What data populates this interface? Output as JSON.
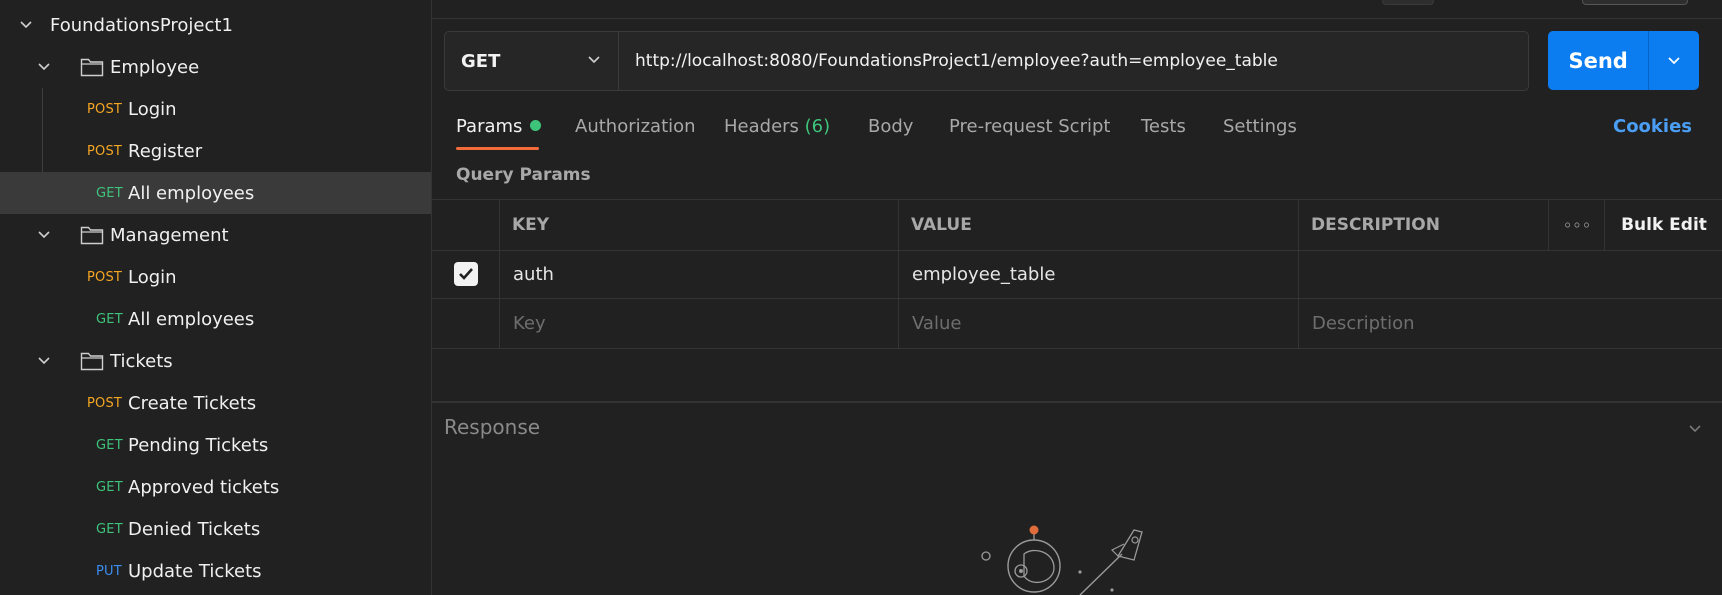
{
  "sidebar": {
    "collection": {
      "name": "FoundationsProject1"
    },
    "folders": [
      {
        "name": "Employee",
        "requests": [
          {
            "method": "POST",
            "name": "Login"
          },
          {
            "method": "POST",
            "name": "Register"
          },
          {
            "method": "GET",
            "name": "All employees"
          }
        ]
      },
      {
        "name": "Management",
        "requests": [
          {
            "method": "POST",
            "name": "Login"
          },
          {
            "method": "GET",
            "name": "All employees"
          }
        ]
      },
      {
        "name": "Tickets",
        "requests": [
          {
            "method": "POST",
            "name": "Create Tickets"
          },
          {
            "method": "GET",
            "name": "Pending Tickets"
          },
          {
            "method": "GET",
            "name": "Approved tickets"
          },
          {
            "method": "GET",
            "name": "Denied Tickets"
          },
          {
            "method": "PUT",
            "name": "Update Tickets"
          }
        ]
      }
    ]
  },
  "request": {
    "method": "GET",
    "url": "http://localhost:8080/FoundationsProject1/employee?auth=employee_table",
    "send_label": "Send"
  },
  "tabs": {
    "params": "Params",
    "authorization": "Authorization",
    "headers": "Headers",
    "headers_count": "(6)",
    "body": "Body",
    "prerequest": "Pre-request Script",
    "tests": "Tests",
    "settings": "Settings",
    "cookies": "Cookies"
  },
  "query_params": {
    "heading": "Query Params",
    "columns": {
      "key": "KEY",
      "value": "VALUE",
      "description": "DESCRIPTION",
      "bulk_edit": "Bulk Edit",
      "more": "◦◦◦"
    },
    "rows": [
      {
        "key": "auth",
        "value": "employee_table",
        "description": "",
        "checked": true
      }
    ],
    "placeholders": {
      "key": "Key",
      "value": "Value",
      "description": "Description"
    }
  },
  "response": {
    "title": "Response"
  },
  "colors": {
    "post": "#f5a623",
    "get": "#3ec47a",
    "put": "#3b8cf0",
    "accent": "#0c7df0",
    "active_tab": "#f26b3a",
    "link": "#4a9ff5"
  }
}
